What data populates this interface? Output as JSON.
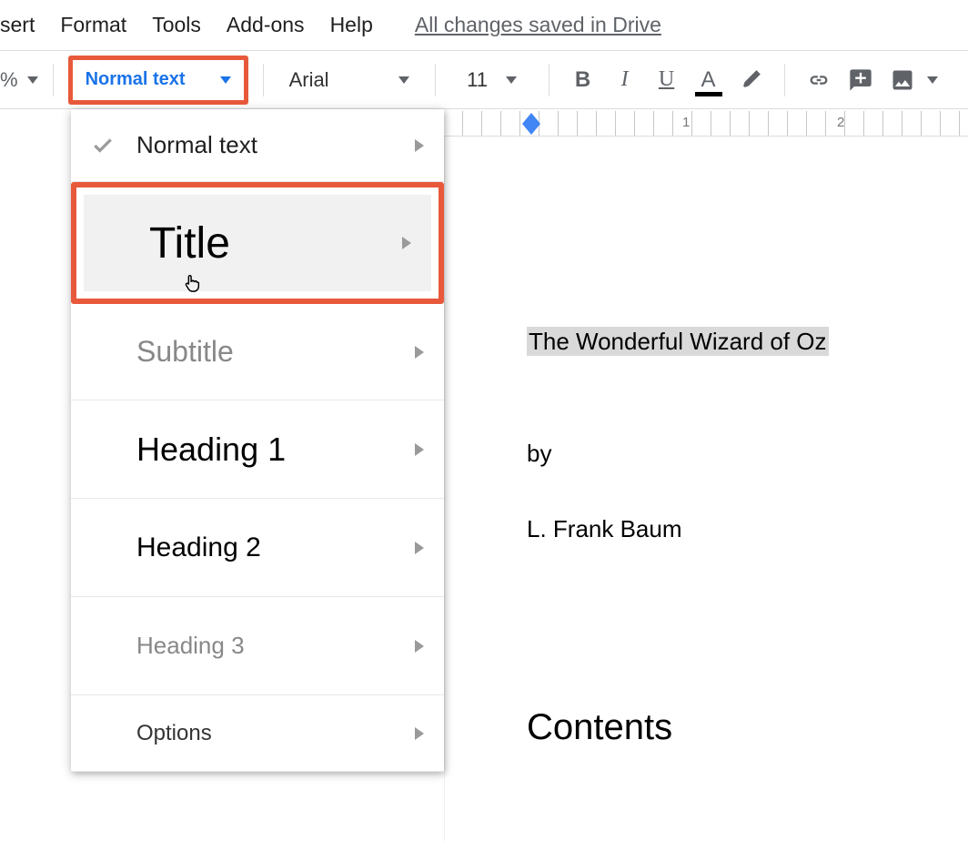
{
  "menubar": {
    "items": [
      "sert",
      "Format",
      "Tools",
      "Add-ons",
      "Help"
    ],
    "save_status": "All changes saved in Drive"
  },
  "toolbar": {
    "zoom_suffix": "%",
    "styles_label": "Normal text",
    "font_label": "Arial",
    "font_size": "11"
  },
  "style_menu": {
    "normal": "Normal text",
    "title": "Title",
    "subtitle": "Subtitle",
    "h1": "Heading 1",
    "h2": "Heading 2",
    "h3": "Heading 3",
    "options": "Options"
  },
  "ruler": {
    "n1": "1",
    "n2": "2"
  },
  "document": {
    "title": "The Wonderful Wizard of Oz",
    "by": "by",
    "author": "L. Frank Baum",
    "contents": "Contents"
  }
}
